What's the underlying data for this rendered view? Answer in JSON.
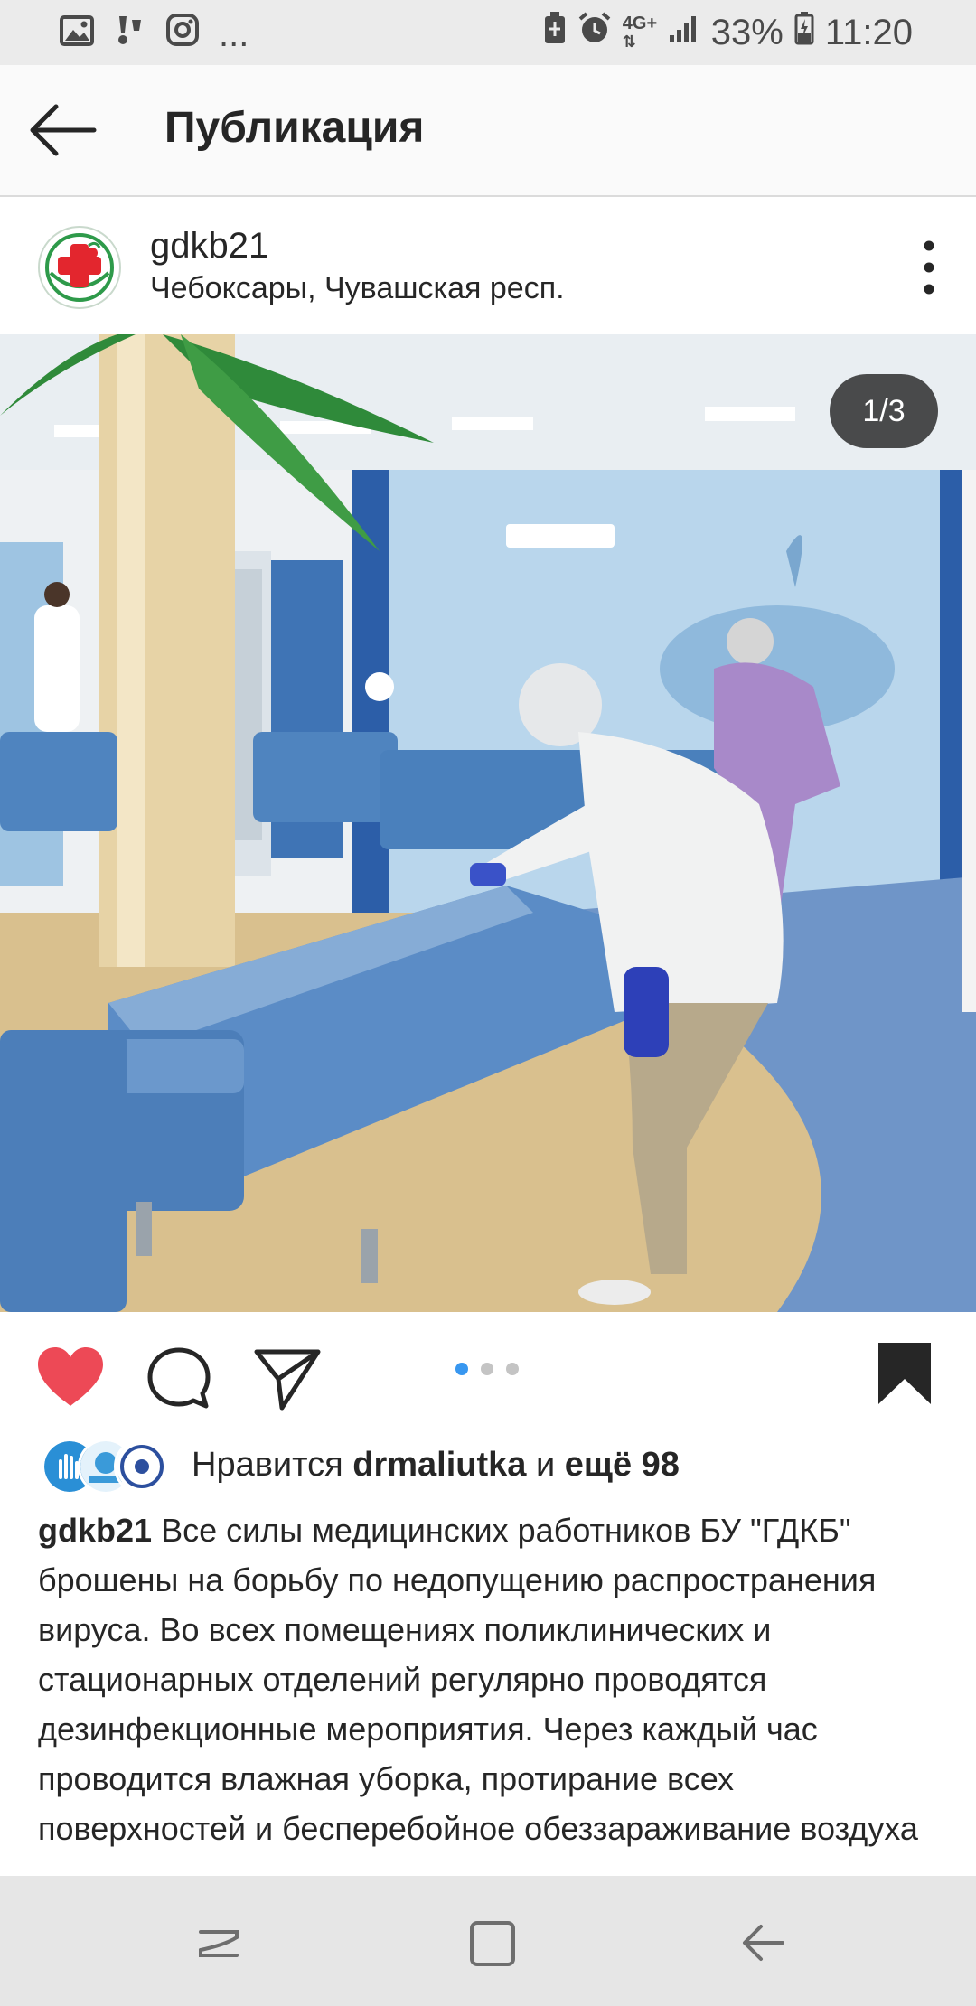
{
  "status_bar": {
    "left_overflow": "...",
    "network": "4G+",
    "battery": "33%",
    "time": "11:20",
    "icons": [
      "image-icon",
      "notification-icon",
      "instagram-icon",
      "battery-saver-icon",
      "alarm-icon",
      "network-4g-icon",
      "signal-icon",
      "battery-icon"
    ]
  },
  "header": {
    "title": "Публикация",
    "back_icon": "arrow-left-icon"
  },
  "post": {
    "username": "gdkb21",
    "location": "Чебоксары, Чувашская респ.",
    "more_icon": "more-vertical-icon",
    "image_counter": "1/3",
    "carousel": {
      "total": 3,
      "active": 1
    },
    "liked": true,
    "saved": true
  },
  "likes": {
    "prefix": "Нравится",
    "user": "drmaliutka",
    "conj": "и",
    "others": "ещё 98"
  },
  "caption": {
    "username": "gdkb21",
    "text": "Все силы медицинских работников БУ \"ГДКБ\" брошены на борьбу по недопущению распространения вируса. Во всех помещениях поликлинических и стационарных отделений регулярно проводятся дезинфекционные мероприятия. Через каждый час проводится влажная уборка, протирание всех поверхностей и бесперебойное обеззараживание воздуха"
  },
  "colors": {
    "like": "#ed4956",
    "carousel_active": "#3897f0",
    "text": "#262626"
  }
}
